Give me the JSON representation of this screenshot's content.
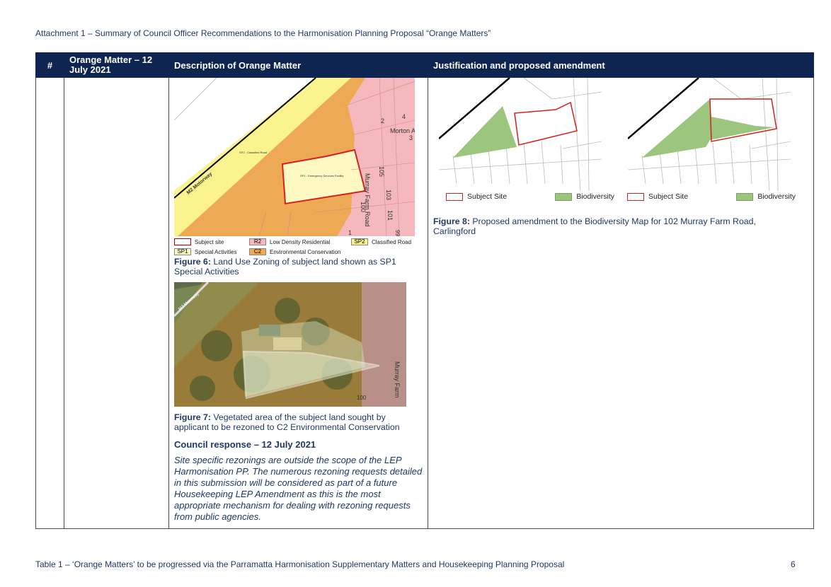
{
  "document": {
    "header": "Attachment 1 – Summary of Council Officer Recommendations to the Harmonisation Planning Proposal “Orange Matters”",
    "footer": "Table 1 – ‘Orange Matters’ to be progressed via the Parramatta Harmonisation Supplementary Matters and Housekeeping Planning Proposal",
    "page_number": "6"
  },
  "table": {
    "columns": [
      "#",
      "Orange Matter – 12 July 2021",
      "Description of Orange Matter",
      "Justification and proposed amendment"
    ]
  },
  "figure6": {
    "map_labels": {
      "motorway": "M2 Motorway",
      "sp2": "SP2 - Classified Road",
      "sp1": "SP1 - Emergency Services Facility",
      "street_morton": "Morton A",
      "street_murray": "Murray Farm Road",
      "n2": "2",
      "n4": "4",
      "n3": "3",
      "n105": "105",
      "n103": "103",
      "n101": "101",
      "n100": "100",
      "n1": "1",
      "n99": "99"
    },
    "legend": {
      "subject": "Subject site",
      "r2_code": "R2",
      "r2": "Low Density Residential",
      "sp2_code": "SP2",
      "sp2": "Classified Road",
      "sp1_code": "SP1",
      "sp1": "Special Activities",
      "c2_code": "C2",
      "c2": "Environmental Conservation"
    },
    "caption_label": "Figure 6:",
    "caption_text": "Land Use Zoning of subject land shown as SP1 Special Activities"
  },
  "figure7": {
    "map_labels": {
      "motorway": "M2 Motorway",
      "road": "Murray Farm",
      "lot": "100"
    },
    "caption_label": "Figure 7:",
    "caption_text": "Vegetated area of the subject land sought by applicant to be rezoned to C2 Environmental Conservation"
  },
  "council": {
    "heading": "Council response – 12 July 2021",
    "text": "Site specific rezonings are outside the scope of the LEP Harmonisation PP. The numerous rezoning requests detailed in this submission will be considered as part of a future Housekeeping LEP Amendment as this is the most appropriate mechanism for dealing with rezoning requests from public agencies."
  },
  "figure8": {
    "legend_subject": "Subject Site",
    "legend_bio": "Biodiversity",
    "caption_label": "Figure 8:",
    "caption_text": "Proposed amendment to the Biodiversity Map for 102 Murray Farm Road, Carlingford"
  },
  "colors": {
    "header_bg": "#0f2551",
    "text": "#1f3864",
    "r2": "#f5b8bc",
    "sp2": "#fbf38d",
    "sp1": "#fdf9c2",
    "c2": "#eda954",
    "subject": "#d62020",
    "biodiversity": "#9cc57e"
  }
}
